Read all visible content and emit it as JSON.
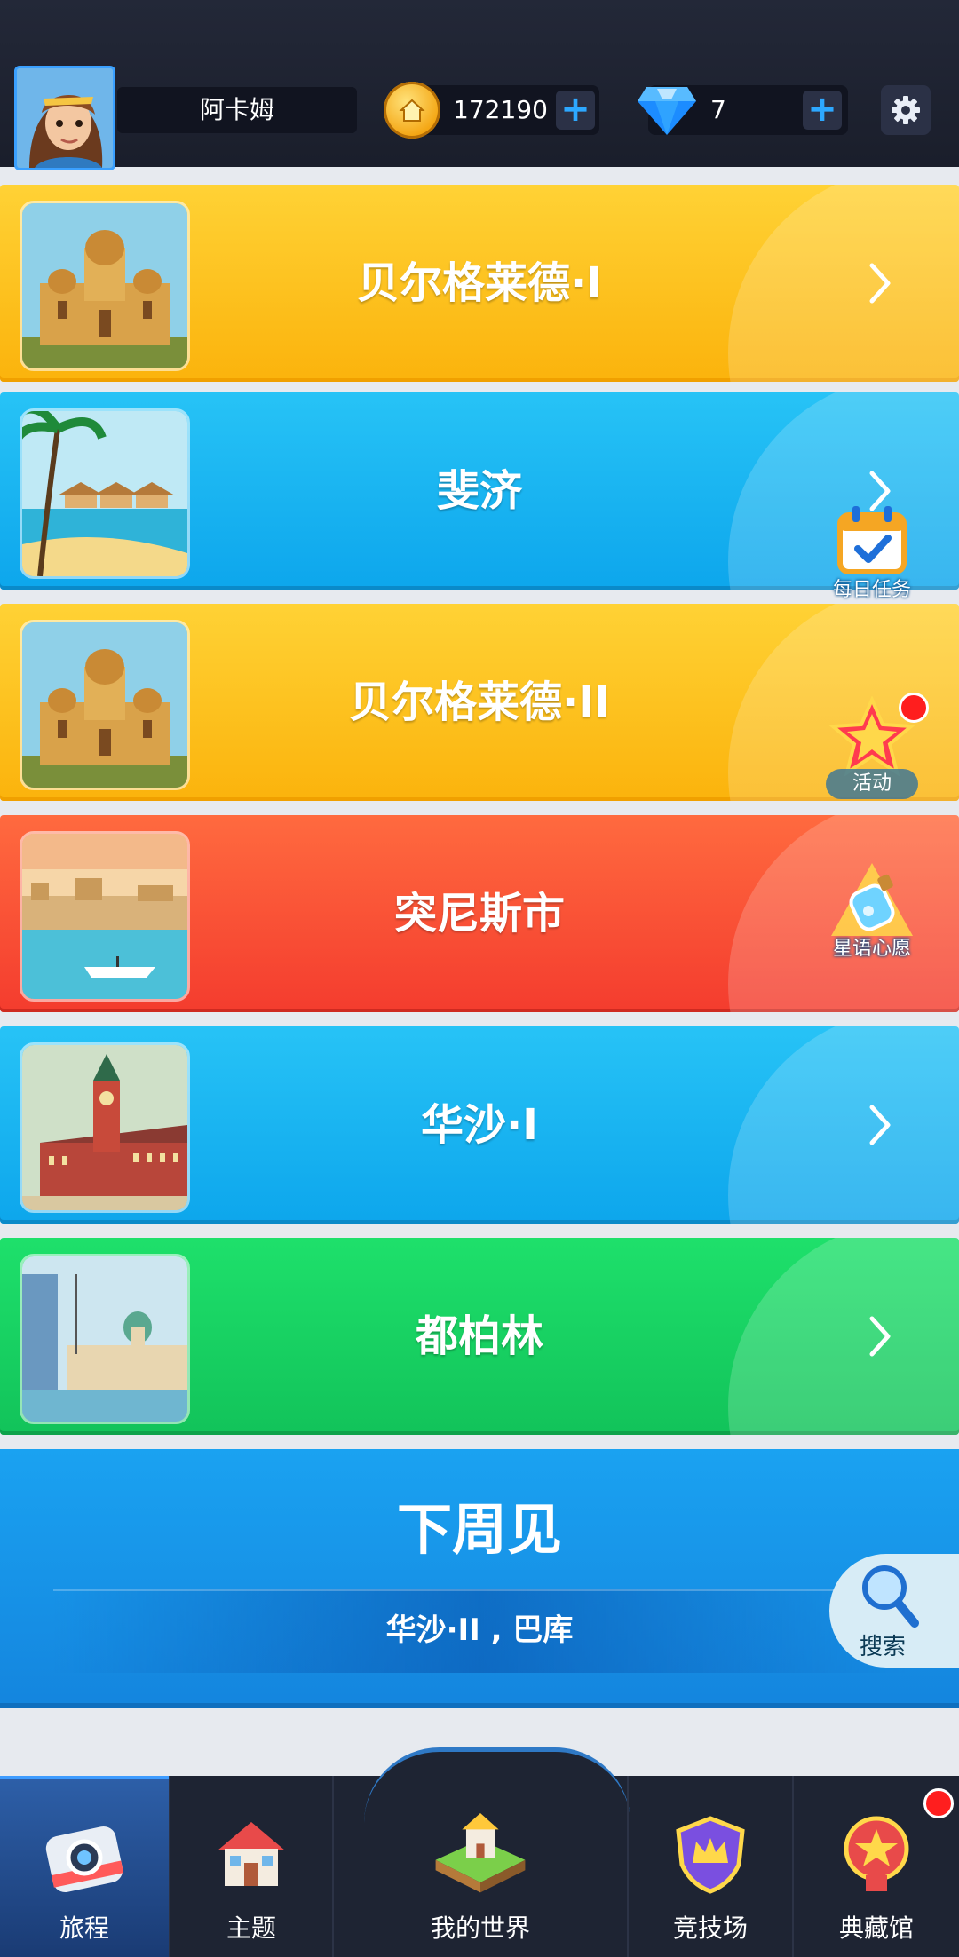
{
  "header": {
    "player_name": "阿卡姆",
    "coins": "172190",
    "gems": "7",
    "plus_label": "+"
  },
  "cities": [
    {
      "name": "贝尔格莱德·I",
      "theme": "yellow",
      "image": "belgrade-cathedral"
    },
    {
      "name": "斐济",
      "theme": "blue",
      "image": "fiji-beach"
    },
    {
      "name": "贝尔格莱德·II",
      "theme": "yellow",
      "image": "belgrade-cathedral"
    },
    {
      "name": "突尼斯市",
      "theme": "red",
      "image": "tunis-harbor"
    },
    {
      "name": "华沙·I",
      "theme": "blue",
      "image": "warsaw-castle"
    },
    {
      "name": "都柏林",
      "theme": "green",
      "image": "dublin-customs-house"
    }
  ],
  "next_week": {
    "title": "下周见",
    "cities": "华沙·II , 巴库"
  },
  "side_buttons": {
    "daily_tasks": "每日任务",
    "events": "活动",
    "wishes": "星语心愿",
    "search": "搜索"
  },
  "bottom_nav": [
    {
      "label": "旅程",
      "icon": "camera-icon",
      "active": true
    },
    {
      "label": "主题",
      "icon": "house-icon",
      "active": false
    },
    {
      "label": "我的世界",
      "icon": "island-icon",
      "active": false
    },
    {
      "label": "竞技场",
      "icon": "crown-shield-icon",
      "active": false
    },
    {
      "label": "典藏馆",
      "icon": "star-medal-icon",
      "active": false
    }
  ],
  "colors": {
    "yellow": "#fbb30c",
    "blue": "#0da6ec",
    "red": "#f43c2e",
    "green": "#12c35a",
    "accent": "#2da8ff"
  }
}
